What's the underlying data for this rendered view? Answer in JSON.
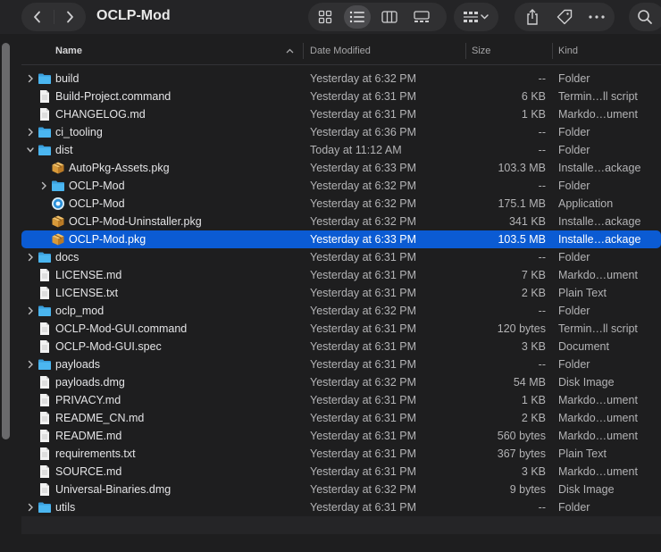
{
  "window": {
    "title": "OCLP-Mod"
  },
  "toolbar": {
    "view_modes": [
      "grid-view-icon",
      "list-view-icon",
      "column-view-icon",
      "gallery-view-icon"
    ],
    "active_view": "list",
    "actions": [
      "group-by-icon",
      "share-icon",
      "tag-icon",
      "more-icon",
      "search-icon"
    ]
  },
  "columns": {
    "name": "Name",
    "date": "Date Modified",
    "size": "Size",
    "kind": "Kind"
  },
  "colors": {
    "selection": "#0b5bd3",
    "folder": "#4bb6f0",
    "background": "#1e1e1f"
  },
  "rows": [
    {
      "name": "build",
      "date": "Yesterday at 6:32 PM",
      "size": "--",
      "kind": "Folder",
      "icon": "folder-icon",
      "depth": 0,
      "disclosure": "collapsed"
    },
    {
      "name": "Build-Project.command",
      "date": "Yesterday at 6:31 PM",
      "size": "6 KB",
      "kind": "Termin…ll script",
      "icon": "document-icon",
      "depth": 0,
      "disclosure": "none"
    },
    {
      "name": "CHANGELOG.md",
      "date": "Yesterday at 6:31 PM",
      "size": "1 KB",
      "kind": "Markdo…ument",
      "icon": "document-icon",
      "depth": 0,
      "disclosure": "none"
    },
    {
      "name": "ci_tooling",
      "date": "Yesterday at 6:36 PM",
      "size": "--",
      "kind": "Folder",
      "icon": "folder-icon",
      "depth": 0,
      "disclosure": "collapsed"
    },
    {
      "name": "dist",
      "date": "Today at 11:12 AM",
      "size": "--",
      "kind": "Folder",
      "icon": "folder-icon",
      "depth": 0,
      "disclosure": "expanded"
    },
    {
      "name": "AutoPkg-Assets.pkg",
      "date": "Yesterday at 6:33 PM",
      "size": "103.3 MB",
      "kind": "Installe…ackage",
      "icon": "package-icon",
      "depth": 1,
      "disclosure": "none"
    },
    {
      "name": "OCLP-Mod",
      "date": "Yesterday at 6:32 PM",
      "size": "--",
      "kind": "Folder",
      "icon": "folder-icon",
      "depth": 1,
      "disclosure": "collapsed"
    },
    {
      "name": "OCLP-Mod",
      "date": "Yesterday at 6:32 PM",
      "size": "175.1 MB",
      "kind": "Application",
      "icon": "app-icon",
      "depth": 1,
      "disclosure": "none"
    },
    {
      "name": "OCLP-Mod-Uninstaller.pkg",
      "date": "Yesterday at 6:32 PM",
      "size": "341 KB",
      "kind": "Installe…ackage",
      "icon": "package-icon",
      "depth": 1,
      "disclosure": "none"
    },
    {
      "name": "OCLP-Mod.pkg",
      "date": "Yesterday at 6:33 PM",
      "size": "103.5 MB",
      "kind": "Installe…ackage",
      "icon": "package-icon",
      "depth": 1,
      "disclosure": "none",
      "selected": true
    },
    {
      "name": "docs",
      "date": "Yesterday at 6:31 PM",
      "size": "--",
      "kind": "Folder",
      "icon": "folder-icon",
      "depth": 0,
      "disclosure": "collapsed"
    },
    {
      "name": "LICENSE.md",
      "date": "Yesterday at 6:31 PM",
      "size": "7 KB",
      "kind": "Markdo…ument",
      "icon": "document-icon",
      "depth": 0,
      "disclosure": "none"
    },
    {
      "name": "LICENSE.txt",
      "date": "Yesterday at 6:31 PM",
      "size": "2 KB",
      "kind": "Plain Text",
      "icon": "document-icon",
      "depth": 0,
      "disclosure": "none"
    },
    {
      "name": "oclp_mod",
      "date": "Yesterday at 6:32 PM",
      "size": "--",
      "kind": "Folder",
      "icon": "folder-icon",
      "depth": 0,
      "disclosure": "collapsed"
    },
    {
      "name": "OCLP-Mod-GUI.command",
      "date": "Yesterday at 6:31 PM",
      "size": "120 bytes",
      "kind": "Termin…ll script",
      "icon": "document-icon",
      "depth": 0,
      "disclosure": "none"
    },
    {
      "name": "OCLP-Mod-GUI.spec",
      "date": "Yesterday at 6:31 PM",
      "size": "3 KB",
      "kind": "Document",
      "icon": "document-icon",
      "depth": 0,
      "disclosure": "none"
    },
    {
      "name": "payloads",
      "date": "Yesterday at 6:31 PM",
      "size": "--",
      "kind": "Folder",
      "icon": "folder-icon",
      "depth": 0,
      "disclosure": "collapsed"
    },
    {
      "name": "payloads.dmg",
      "date": "Yesterday at 6:32 PM",
      "size": "54 MB",
      "kind": "Disk Image",
      "icon": "document-icon",
      "depth": 0,
      "disclosure": "none"
    },
    {
      "name": "PRIVACY.md",
      "date": "Yesterday at 6:31 PM",
      "size": "1 KB",
      "kind": "Markdo…ument",
      "icon": "document-icon",
      "depth": 0,
      "disclosure": "none"
    },
    {
      "name": "README_CN.md",
      "date": "Yesterday at 6:31 PM",
      "size": "2 KB",
      "kind": "Markdo…ument",
      "icon": "document-icon",
      "depth": 0,
      "disclosure": "none"
    },
    {
      "name": "README.md",
      "date": "Yesterday at 6:31 PM",
      "size": "560 bytes",
      "kind": "Markdo…ument",
      "icon": "document-icon",
      "depth": 0,
      "disclosure": "none"
    },
    {
      "name": "requirements.txt",
      "date": "Yesterday at 6:31 PM",
      "size": "367 bytes",
      "kind": "Plain Text",
      "icon": "document-icon",
      "depth": 0,
      "disclosure": "none"
    },
    {
      "name": "SOURCE.md",
      "date": "Yesterday at 6:31 PM",
      "size": "3 KB",
      "kind": "Markdo…ument",
      "icon": "document-icon",
      "depth": 0,
      "disclosure": "none"
    },
    {
      "name": "Universal-Binaries.dmg",
      "date": "Yesterday at 6:32 PM",
      "size": "9 bytes",
      "kind": "Disk Image",
      "icon": "document-icon",
      "depth": 0,
      "disclosure": "none"
    },
    {
      "name": "utils",
      "date": "Yesterday at 6:31 PM",
      "size": "--",
      "kind": "Folder",
      "icon": "folder-icon",
      "depth": 0,
      "disclosure": "collapsed"
    }
  ]
}
